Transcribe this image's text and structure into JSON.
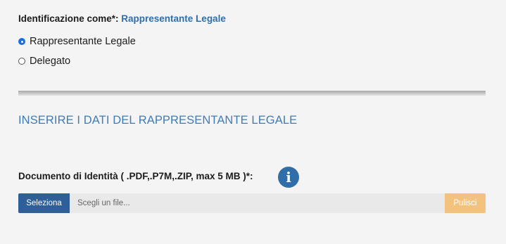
{
  "identification": {
    "label": "Identificazione come*: ",
    "value": "Rappresentante Legale"
  },
  "radio_options": [
    {
      "label": "Rappresentante Legale",
      "checked": true
    },
    {
      "label": "Delegato",
      "checked": false
    }
  ],
  "section_title": "INSERIRE I DATI DEL RAPPRESENTANTE LEGALE",
  "document": {
    "label": "Documento di Identità ( .PDF,.P7M,.ZIP, max 5 MB )*:",
    "info_icon": "info-circle-icon",
    "select_button": "Seleziona",
    "file_placeholder": "Scegli un file...",
    "clear_button": "Pulisci"
  },
  "colors": {
    "accent_blue": "#2f6ea9",
    "select_button_bg": "#2f5f99",
    "clear_button_bg": "#f3c27e",
    "radio_checked": "#1a6fe0"
  }
}
